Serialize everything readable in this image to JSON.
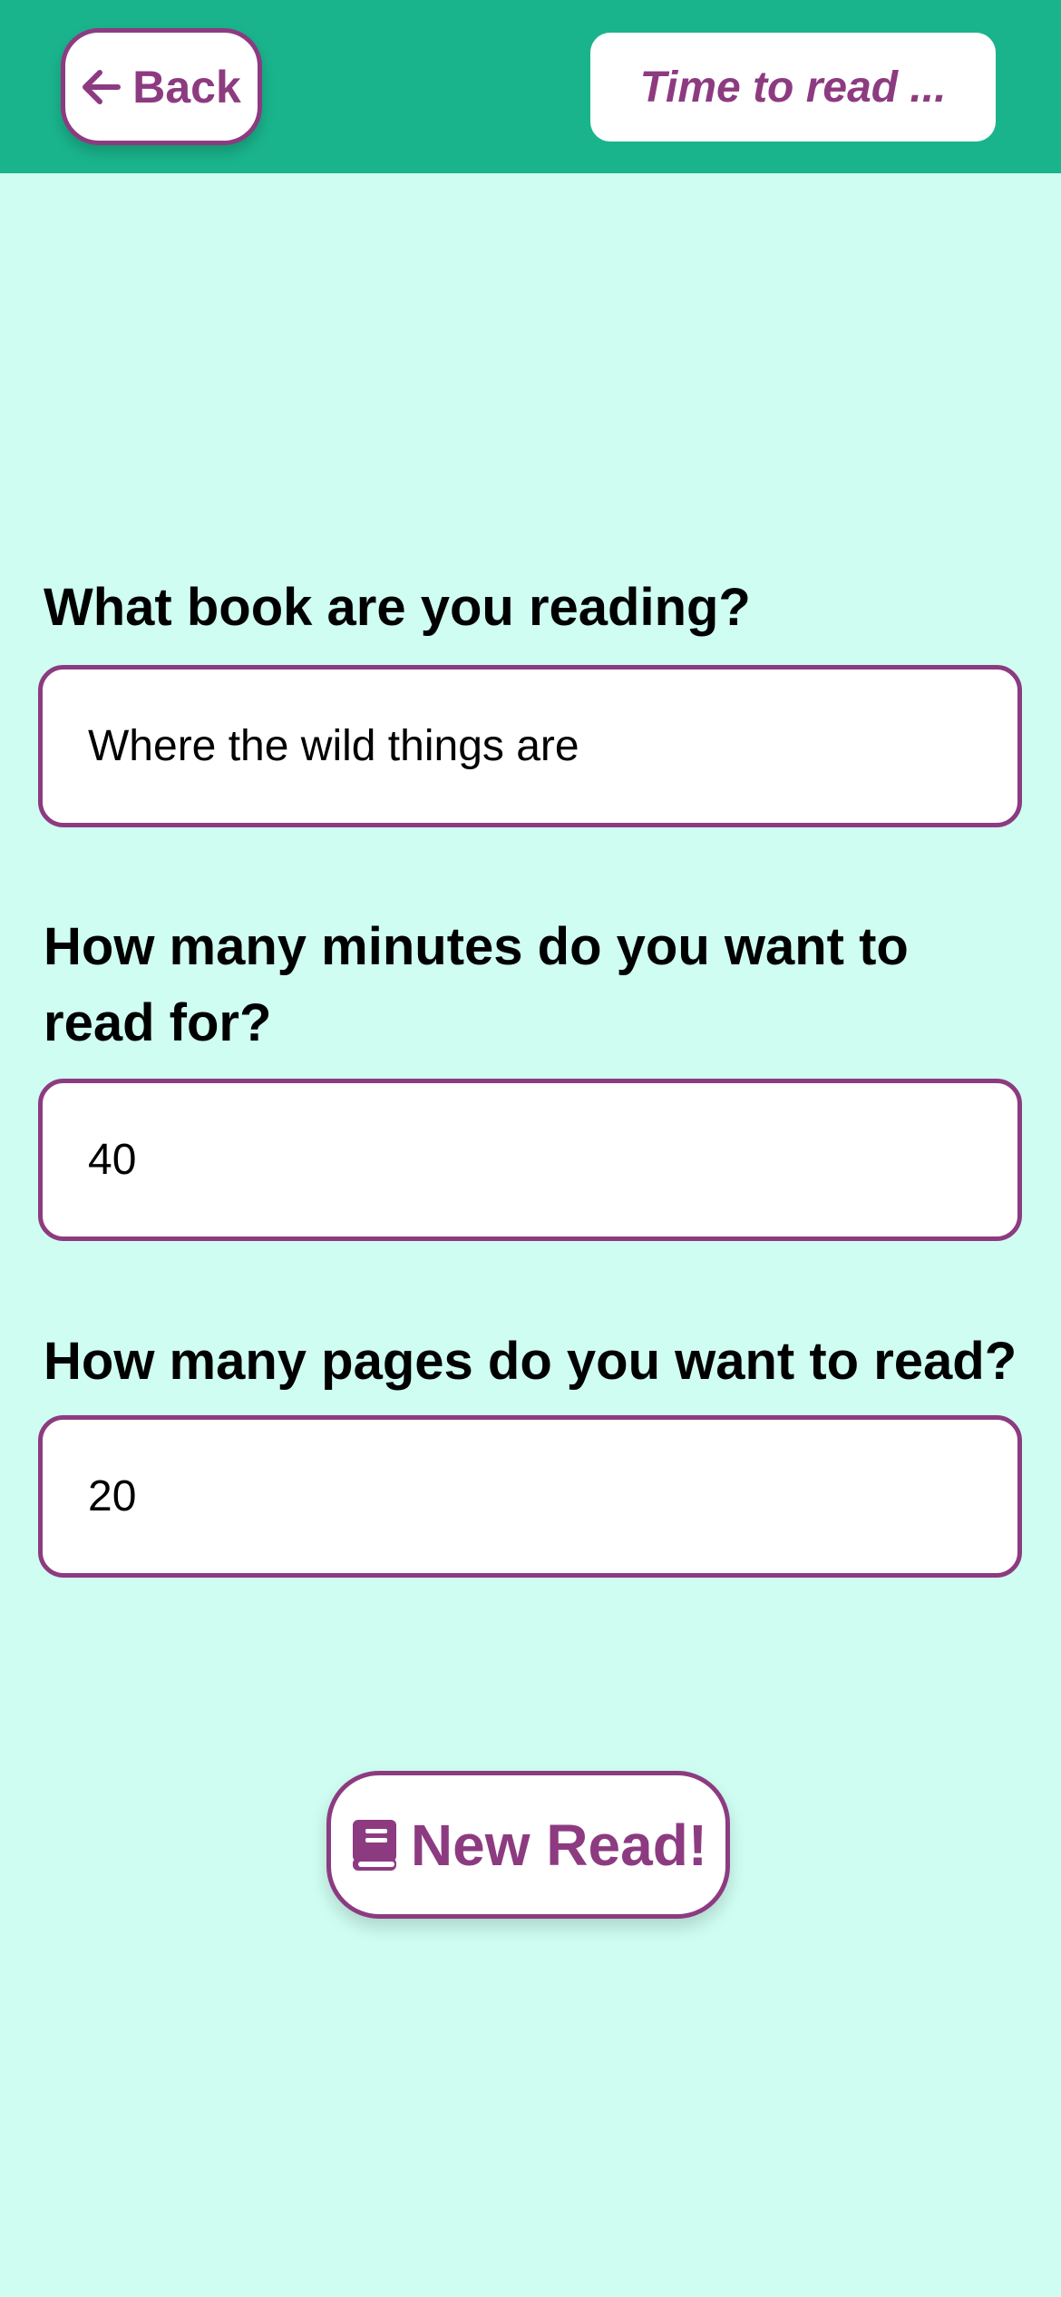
{
  "header": {
    "back_label": "Back",
    "title": "Time to read ..."
  },
  "form": {
    "book": {
      "label": "What book are you reading?",
      "value": "Where the wild things are"
    },
    "minutes": {
      "label": "How many minutes do you want to read for?",
      "value": "40"
    },
    "pages": {
      "label": "How many pages do you want to read?",
      "value": "20"
    },
    "submit_label": "New Read!"
  },
  "icons": {
    "back": "arrow-left-icon",
    "submit": "book-icon"
  },
  "colors": {
    "header_bg": "#1ab48c",
    "page_bg": "#cffdf1",
    "accent": "#8d3b81"
  }
}
